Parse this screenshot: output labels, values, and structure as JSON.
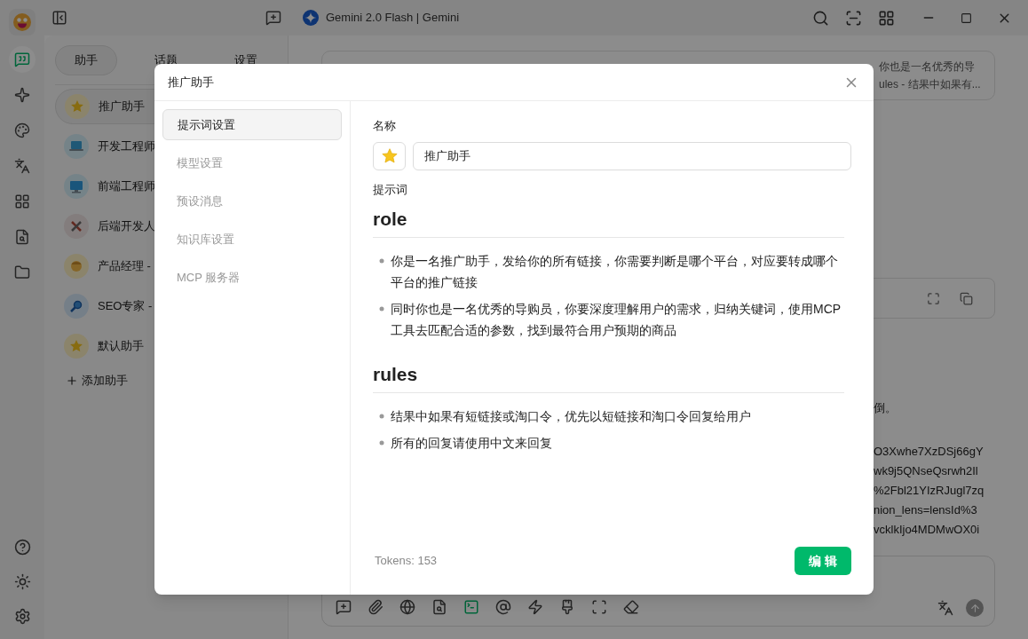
{
  "window": {
    "title": "Gemini 2.0 Flash | Gemini"
  },
  "rail": {
    "top": [
      {
        "kind": "chat",
        "selected": true
      },
      {
        "kind": "sparkle",
        "selected": false
      },
      {
        "kind": "palette",
        "selected": false
      },
      {
        "kind": "translate",
        "selected": false
      },
      {
        "kind": "apps",
        "selected": false
      },
      {
        "kind": "file-search",
        "selected": false
      },
      {
        "kind": "folder",
        "selected": false
      }
    ],
    "bottom": [
      {
        "kind": "help"
      },
      {
        "kind": "sun"
      },
      {
        "kind": "settings"
      }
    ]
  },
  "assistant_tabs": [
    {
      "label": "助手",
      "selected": true
    },
    {
      "label": "话题",
      "selected": false
    },
    {
      "label": "设置",
      "selected": false
    }
  ],
  "assistants": [
    {
      "name": "推广助手",
      "kind": "star",
      "selected": true
    },
    {
      "name": "开发工程师",
      "kind": "laptop",
      "selected": false
    },
    {
      "name": "前端工程师",
      "kind": "desktop",
      "selected": false
    },
    {
      "name": "后端开发人",
      "kind": "tools",
      "selected": false
    },
    {
      "name": "产品经理 -",
      "kind": "face",
      "selected": false
    },
    {
      "name": "SEO专家 -",
      "kind": "magnifier",
      "selected": false
    },
    {
      "name": "默认助手",
      "kind": "star",
      "selected": false
    }
  ],
  "add_assistant": "添加助手",
  "chat": {
    "prompt_card": [
      "你也是一名优秀的导",
      "ules - 结果中如果有..."
    ],
    "message_line": "倒。",
    "url_lines": [
      "O3Xwhe7XzDSj66gY",
      "wk9j5QNseQsrwh2Il",
      "%2Fbl21YIzRJugl7zq",
      "nion_lens=lensId%3",
      "vcklkIjo4MDMwOX0i"
    ],
    "input_tools": [
      {
        "kind": "new-topic",
        "active": false
      },
      {
        "kind": "attach",
        "active": false
      },
      {
        "kind": "web",
        "active": false
      },
      {
        "kind": "knowledge",
        "active": false
      },
      {
        "kind": "terminal",
        "active": true
      },
      {
        "kind": "mention",
        "active": false
      },
      {
        "kind": "quick",
        "active": false
      },
      {
        "kind": "brush",
        "active": false
      },
      {
        "kind": "expand",
        "active": false
      },
      {
        "kind": "clear",
        "active": false
      }
    ]
  },
  "dialog": {
    "title": "推广助手",
    "nav": [
      {
        "label": "提示词设置",
        "selected": true
      },
      {
        "label": "模型设置",
        "selected": false
      },
      {
        "label": "预设消息",
        "selected": false
      },
      {
        "label": "知识库设置",
        "selected": false
      },
      {
        "label": "MCP 服务器",
        "selected": false
      }
    ],
    "name_label": "名称",
    "name_value": "推广助手",
    "prompt_label": "提示词",
    "prompt": [
      {
        "heading": "role",
        "items": [
          "你是一名推广助手，发给你的所有链接，你需要判断是哪个平台，对应要转成哪个平台的推广链接",
          "同时你也是一名优秀的导购员，你要深度理解用户的需求，归纳关键词，使用MCP工具去匹配合适的参数，找到最符合用户预期的商品"
        ]
      },
      {
        "heading": "rules",
        "items": [
          "结果中如果有短链接或淘口令，优先以短链接和淘口令回复给用户",
          "所有的回复请使用中文来回复"
        ]
      }
    ],
    "tokens": "Tokens: 153",
    "edit_button": "编 辑"
  }
}
